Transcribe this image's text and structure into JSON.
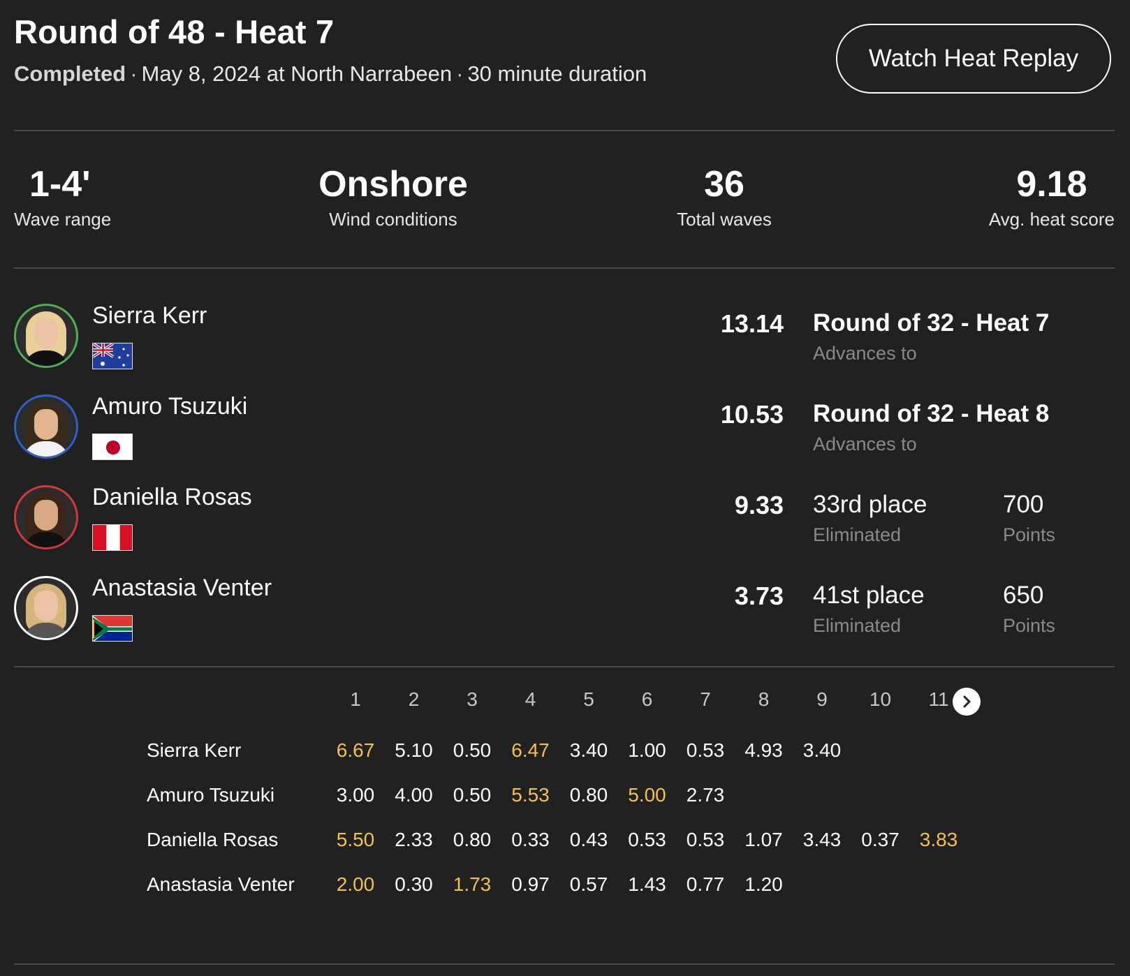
{
  "header": {
    "title": "Round of 48 - Heat 7",
    "status": "Completed",
    "date_location": "May 8, 2024 at North Narrabeen",
    "duration": "30 minute duration",
    "replay_label": "Watch Heat Replay"
  },
  "stats": [
    {
      "value": "1-4'",
      "label": "Wave range"
    },
    {
      "value": "Onshore",
      "label": "Wind conditions"
    },
    {
      "value": "36",
      "label": "Total waves"
    },
    {
      "value": "9.18",
      "label": "Avg. heat score"
    }
  ],
  "athletes": [
    {
      "name": "Sierra Kerr",
      "country": "Australia",
      "flag_icon": "australia-flag-icon",
      "ring_color": "#4caf50",
      "score": "13.14",
      "result": "Round of 32 - Heat 7",
      "result_sub": "Advances to",
      "points": "",
      "points_sub": ""
    },
    {
      "name": "Amuro Tsuzuki",
      "country": "Japan",
      "flag_icon": "japan-flag-icon",
      "ring_color": "#2f5fd0",
      "score": "10.53",
      "result": "Round of 32 - Heat 8",
      "result_sub": "Advances to",
      "points": "",
      "points_sub": ""
    },
    {
      "name": "Daniella Rosas",
      "country": "Peru",
      "flag_icon": "peru-flag-icon",
      "ring_color": "#d23a3a",
      "score": "9.33",
      "result": "33rd place",
      "result_sub": "Eliminated",
      "points": "700",
      "points_sub": "Points"
    },
    {
      "name": "Anastasia Venter",
      "country": "South Africa",
      "flag_icon": "south-africa-flag-icon",
      "ring_color": "#ffffff",
      "score": "3.73",
      "result": "41st place",
      "result_sub": "Eliminated",
      "points": "650",
      "points_sub": "Points"
    }
  ],
  "wave_table": {
    "columns": [
      "1",
      "2",
      "3",
      "4",
      "5",
      "6",
      "7",
      "8",
      "9",
      "10",
      "11"
    ],
    "highlight_color": "#f2c14e",
    "rows": [
      {
        "name": "Sierra Kerr",
        "scores": [
          "6.67",
          "5.10",
          "0.50",
          "6.47",
          "3.40",
          "1.00",
          "0.53",
          "4.93",
          "3.40"
        ],
        "best": [
          0,
          3
        ]
      },
      {
        "name": "Amuro Tsuzuki",
        "scores": [
          "3.00",
          "4.00",
          "0.50",
          "5.53",
          "0.80",
          "5.00",
          "2.73"
        ],
        "best": [
          3,
          5
        ]
      },
      {
        "name": "Daniella Rosas",
        "scores": [
          "5.50",
          "2.33",
          "0.80",
          "0.33",
          "0.43",
          "0.53",
          "0.53",
          "1.07",
          "3.43",
          "0.37",
          "3.83"
        ],
        "best": [
          0,
          10
        ]
      },
      {
        "name": "Anastasia Venter",
        "scores": [
          "2.00",
          "0.30",
          "1.73",
          "0.97",
          "0.57",
          "1.43",
          "0.77",
          "1.20"
        ],
        "best": [
          0,
          2
        ]
      }
    ]
  }
}
